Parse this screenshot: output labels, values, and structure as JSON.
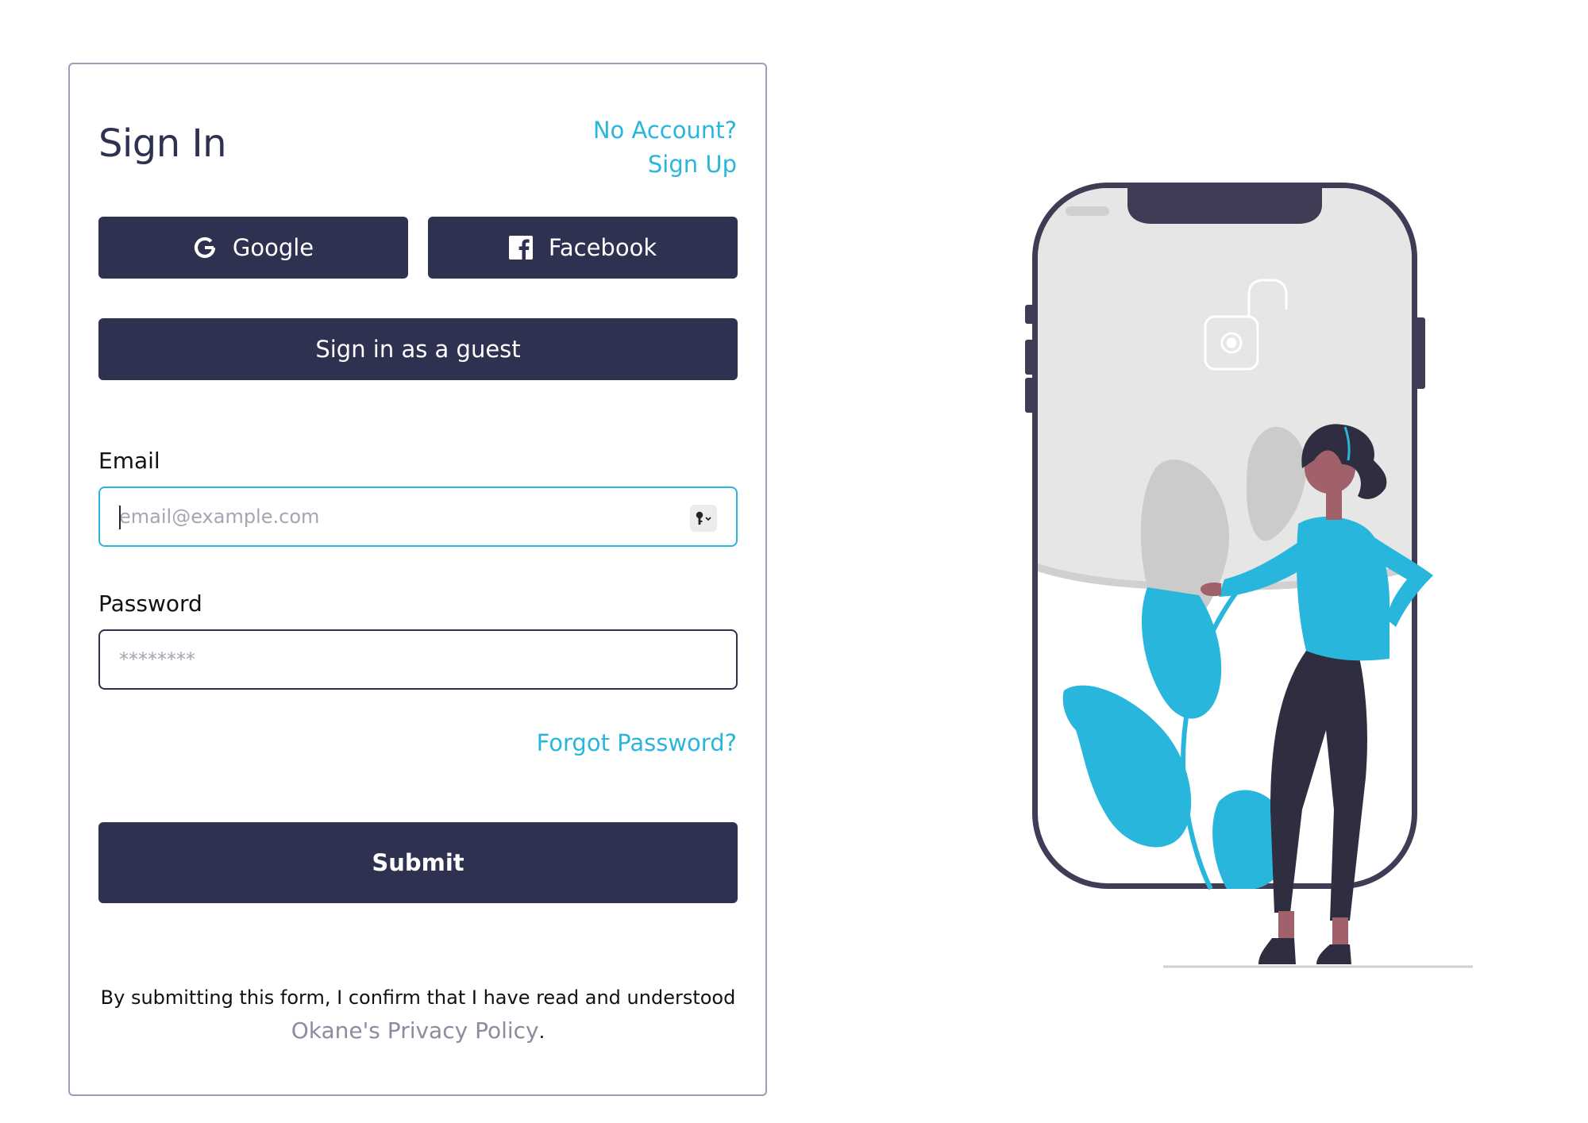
{
  "signin": {
    "title": "Sign In",
    "no_account": "No Account?",
    "sign_up": "Sign Up"
  },
  "social": {
    "google_label": "Google",
    "google_icon": "google-icon",
    "facebook_label": "Facebook",
    "facebook_icon": "facebook-icon"
  },
  "guest_label": "Sign in as a guest",
  "email": {
    "label": "Email",
    "placeholder": "email@example.com",
    "value": "",
    "icon": "keychain-icon"
  },
  "password": {
    "label": "Password",
    "placeholder": "********",
    "value": ""
  },
  "forgot_label": "Forgot Password?",
  "submit_label": "Submit",
  "disclaimer": {
    "text": "By submitting this form, I confirm that I have read and understood",
    "link": "Okane's Privacy Policy",
    "suffix": "."
  },
  "colors": {
    "primary": "#2e3250",
    "accent": "#29b6dc",
    "muted": "#8a8d9f"
  }
}
